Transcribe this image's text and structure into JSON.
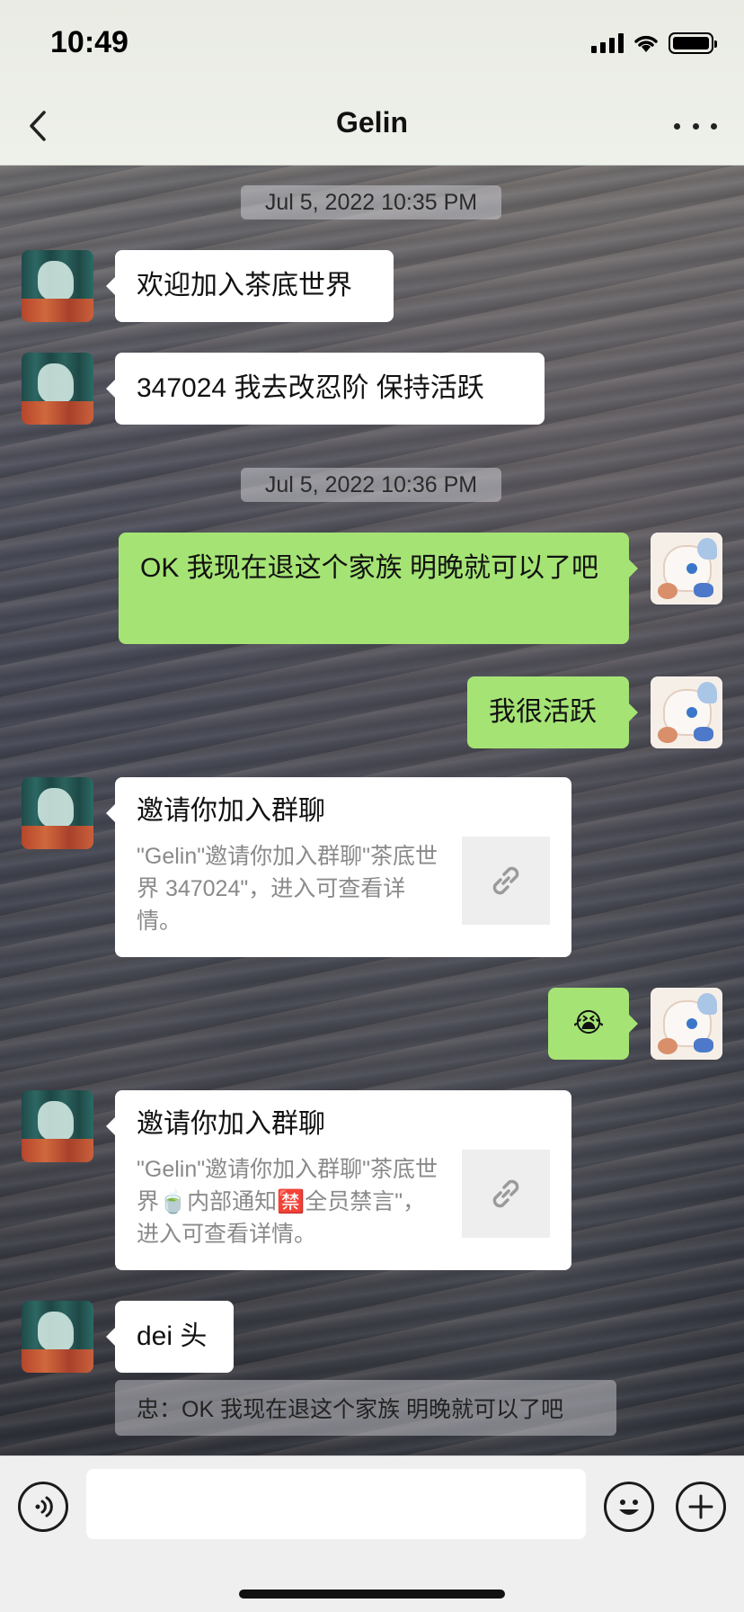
{
  "status_bar": {
    "time": "10:49"
  },
  "nav": {
    "title": "Gelin"
  },
  "messages": {
    "timestamp_1": "Jul 5, 2022 10:35 PM",
    "friend_1": "欢迎加入茶底世界",
    "friend_2": "347024 我去改忍阶 保持活跃",
    "timestamp_2": "Jul 5, 2022 10:36 PM",
    "me_1": "OK 我现在退这个家族 明晚就可以了吧",
    "me_2": "我很活跃",
    "card_1": {
      "title": "邀请你加入群聊",
      "body": "\"Gelin\"邀请你加入群聊\"茶底世界 347024\"，进入可查看详情。"
    },
    "me_3": "😭",
    "card_2": {
      "title": "邀请你加入群聊",
      "body": "\"Gelin\"邀请你加入群聊\"茶底世界🍵内部通知🈲全员禁言\"，进入可查看详情。"
    },
    "friend_3": "dei 头",
    "quote": "忠：OK 我现在退这个家族 明晚就可以了吧"
  },
  "input": {
    "placeholder": ""
  },
  "icons": {
    "back": "chevron-left-icon",
    "more": "more-dots-icon",
    "voice": "voice-icon",
    "emoji": "emoji-icon",
    "plus": "plus-icon",
    "link": "link-icon"
  },
  "colors": {
    "green_bubble": "#a5e474",
    "white_bubble": "#ffffff"
  }
}
